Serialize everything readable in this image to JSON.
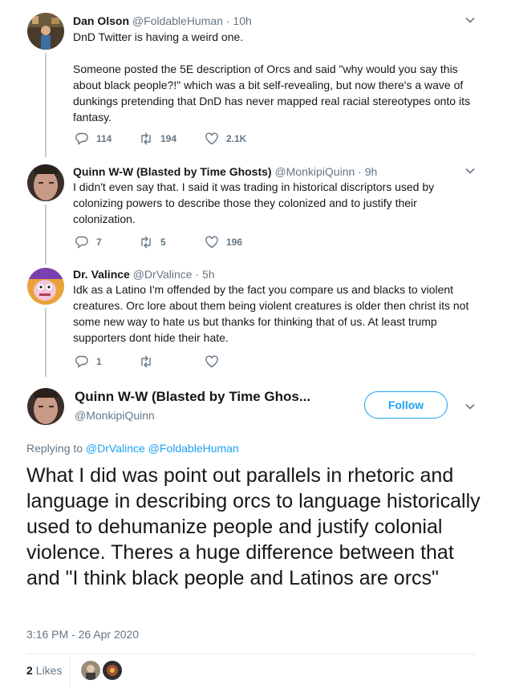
{
  "tweets": [
    {
      "name": "Dan Olson",
      "handle": "@FoldableHuman",
      "time": "10h",
      "text": "DnD Twitter is having a weird one.\n\nSomeone posted the 5E description of Orcs and said \"why would you say this about black people?!\" which was a bit self-revealing, but now there's a wave of dunkings pretending that DnD has never mapped real racial stereotypes onto its fantasy.",
      "replies": "114",
      "retweets": "194",
      "likes": "2.1K"
    },
    {
      "name": "Quinn W-W (Blasted by Time Ghosts)",
      "handle": "@MonkipiQuinn",
      "time": "9h",
      "text": "I didn't even say that. I said it was trading in historical discriptors used by colonizing powers to describe those they colonized and to justify their colonization.",
      "replies": "7",
      "retweets": "5",
      "likes": "196"
    },
    {
      "name": "Dr. Valince",
      "handle": "@DrValince",
      "time": "5h",
      "text": "Idk as a Latino I'm offended by the fact you compare us and blacks to violent creatures. Orc lore about them being violent creatures is older then christ its not some new way to hate us but thanks for thinking that of us. At least trump supporters dont hide their hate.",
      "replies": "1",
      "retweets": "",
      "likes": ""
    }
  ],
  "main": {
    "name": "Quinn W-W (Blasted by Time Ghos...",
    "handle": "@MonkipiQuinn",
    "follow_label": "Follow",
    "replying_prefix": "Replying to ",
    "replying_to_1": "@DrValince",
    "replying_to_2": "@FoldableHuman",
    "text": "What I did was point out parallels in rhetoric and language in describing orcs to language historically used to dehumanize people and justify colonial violence. Theres a huge difference between that and \"I think black people and Latinos are orcs\"",
    "timestamp": "3:16 PM - 26 Apr 2020",
    "likes_count": "2",
    "likes_label": "Likes"
  },
  "colors": {
    "accent": "#1da1f2",
    "muted": "#657786",
    "thread_line": "#c4cfd6"
  },
  "icons": [
    "reply-icon",
    "retweet-icon",
    "like-icon",
    "chevron-down-icon"
  ]
}
